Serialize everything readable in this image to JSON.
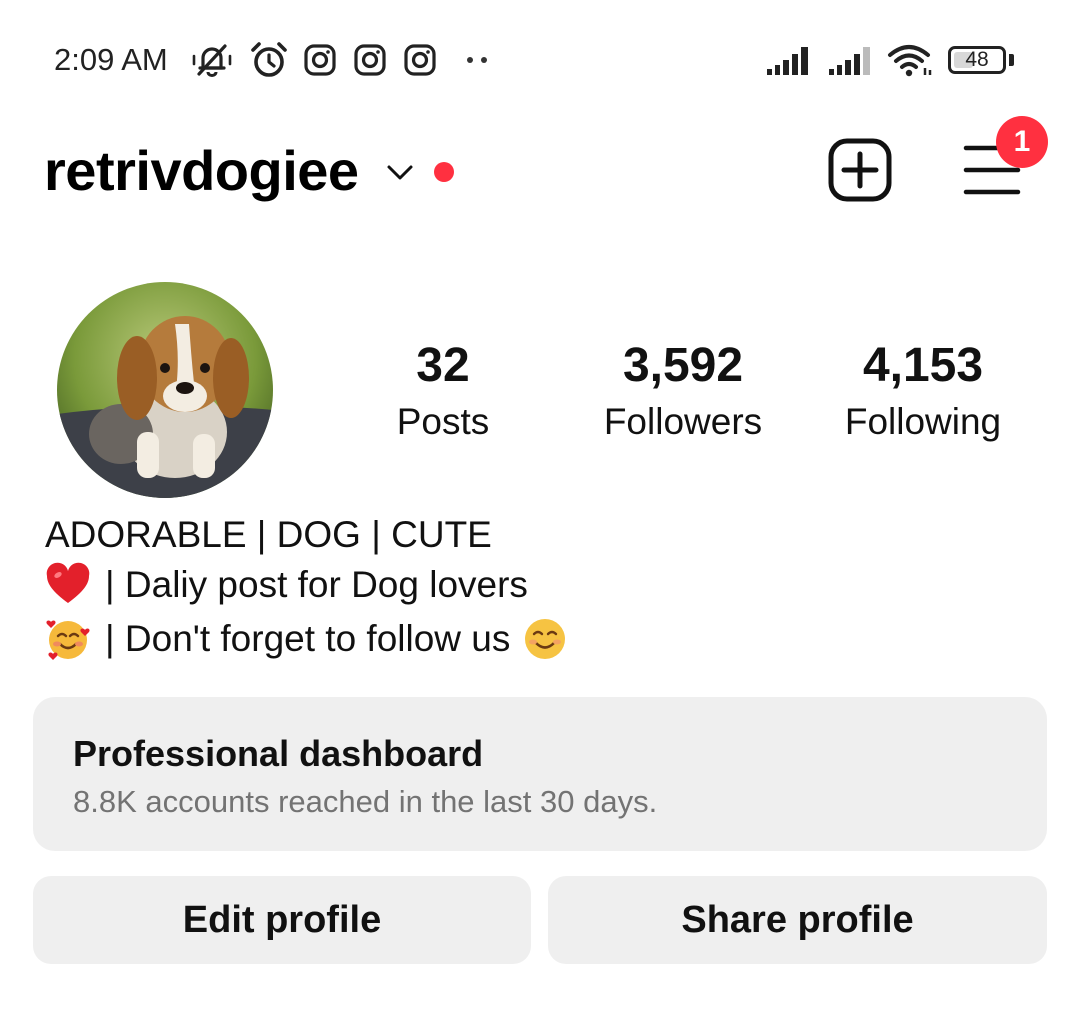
{
  "status_bar": {
    "time": "2:09 AM",
    "battery": "48",
    "battery_level": 0.48,
    "icons": [
      "muted-bell-icon",
      "alarm-icon",
      "instagram-icon",
      "instagram-icon",
      "instagram-icon",
      "more-dots-icon",
      "signal-icon",
      "signal-icon",
      "wifi-icon",
      "battery-icon"
    ]
  },
  "header": {
    "username": "retrivdogiee",
    "notification_count": "1",
    "icons": [
      "chevron-down-icon",
      "add-post-icon",
      "menu-icon"
    ]
  },
  "stats": [
    {
      "value": "32",
      "label": "Posts"
    },
    {
      "value": "3,592",
      "label": "Followers"
    },
    {
      "value": "4,153",
      "label": "Following"
    }
  ],
  "bio": {
    "title": "ADORABLE | DOG | CUTE",
    "line1": "| Daliy post for Dog lovers",
    "line2": "| Don't forget to follow us",
    "emojis": [
      "red-heart-emoji",
      "smiling-face-with-hearts-emoji",
      "smiling-face-emoji"
    ]
  },
  "dashboard": {
    "title": "Professional dashboard",
    "subtitle": "8.8K accounts reached in the last 30 days."
  },
  "actions": {
    "edit": "Edit profile",
    "share": "Share profile"
  },
  "colors": {
    "accent_red": "#ff3040",
    "button_bg": "#efefef",
    "muted_text": "#737373"
  }
}
